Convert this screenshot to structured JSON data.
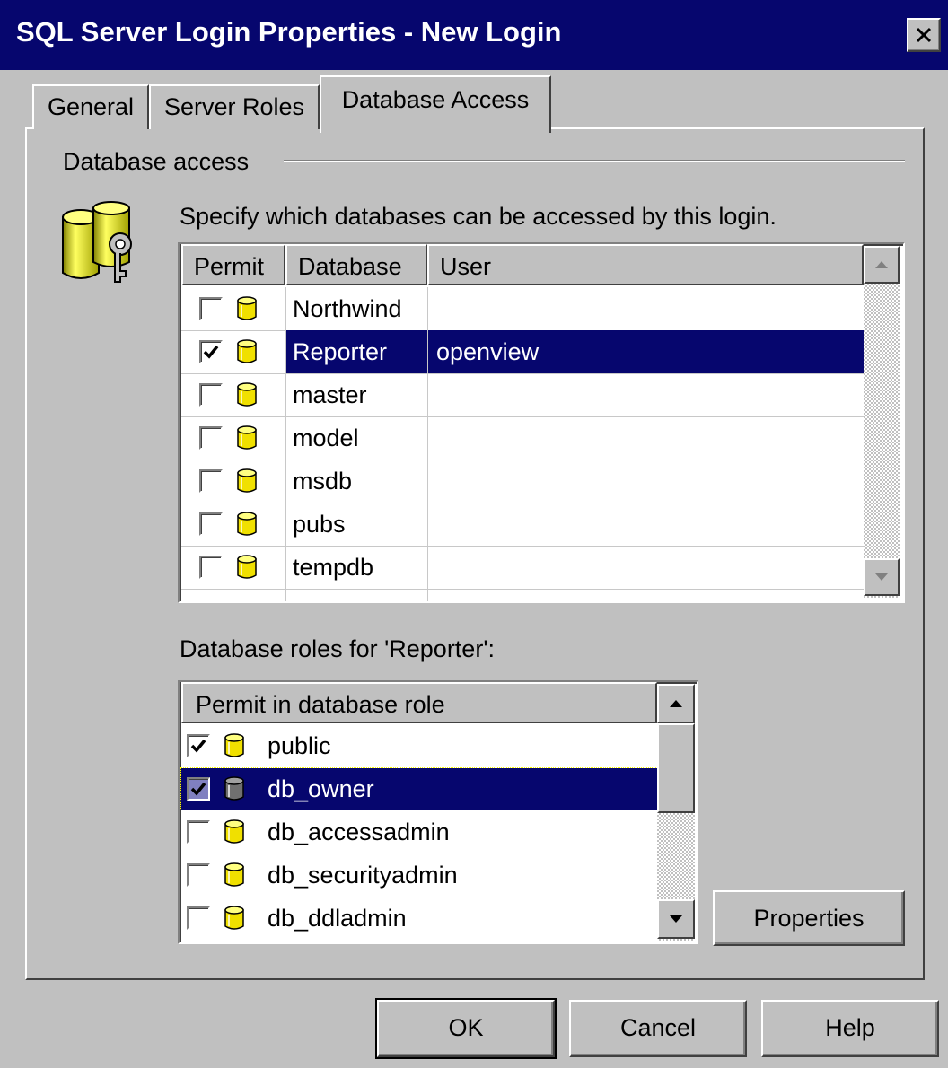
{
  "window": {
    "title": "SQL Server Login Properties - New Login"
  },
  "tabs": [
    {
      "label": "General"
    },
    {
      "label": "Server Roles"
    },
    {
      "label": "Database Access",
      "active": true
    }
  ],
  "group": {
    "label": "Database access"
  },
  "databases": {
    "prompt": "Specify which databases can be accessed by this login.",
    "columns": [
      "Permit",
      "Database",
      "User"
    ],
    "rows": [
      {
        "permit": false,
        "database": "Northwind",
        "user": ""
      },
      {
        "permit": true,
        "database": "Reporter",
        "user": "openview",
        "selected": true
      },
      {
        "permit": false,
        "database": "master",
        "user": ""
      },
      {
        "permit": false,
        "database": "model",
        "user": ""
      },
      {
        "permit": false,
        "database": "msdb",
        "user": ""
      },
      {
        "permit": false,
        "database": "pubs",
        "user": ""
      },
      {
        "permit": false,
        "database": "tempdb",
        "user": ""
      }
    ]
  },
  "roles": {
    "label": "Database roles for 'Reporter':",
    "column": "Permit in database role",
    "rows": [
      {
        "permit": true,
        "name": "public"
      },
      {
        "permit": true,
        "name": "db_owner",
        "selected": true
      },
      {
        "permit": false,
        "name": "db_accessadmin"
      },
      {
        "permit": false,
        "name": "db_securityadmin"
      },
      {
        "permit": false,
        "name": "db_ddladmin"
      }
    ]
  },
  "buttons": {
    "properties": "Properties",
    "ok": "OK",
    "cancel": "Cancel",
    "help": "Help"
  },
  "colors": {
    "titlebar": "#06066e",
    "selection": "#06066e",
    "face": "#c0c0c0",
    "db_icon": "#f0e000"
  }
}
